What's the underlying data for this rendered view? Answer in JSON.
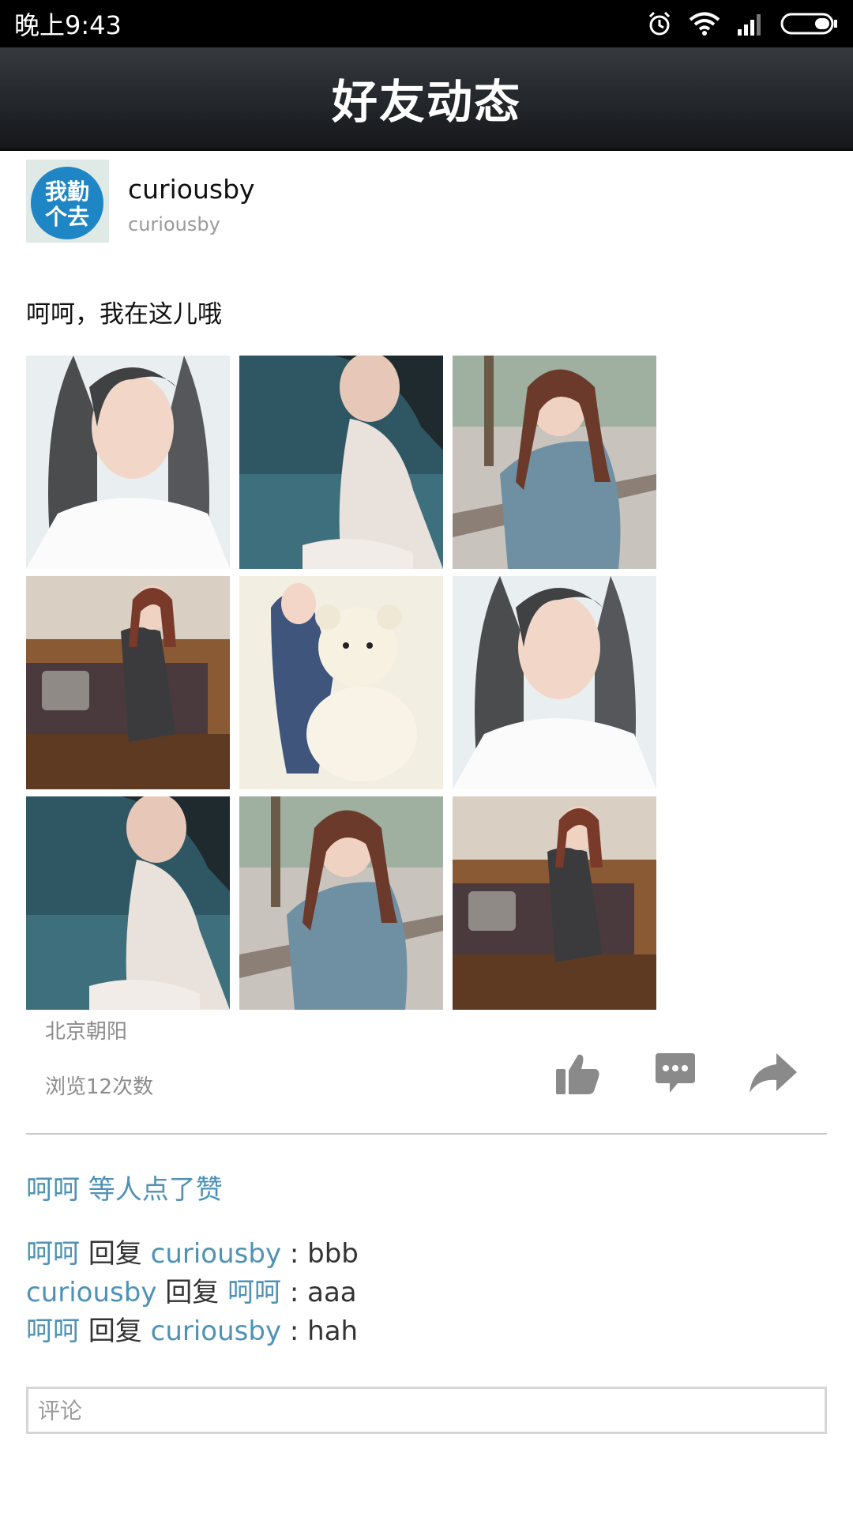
{
  "status_bar": {
    "time": "晚上9:43"
  },
  "header": {
    "title": "好友动态"
  },
  "post": {
    "username": "curiousby",
    "subname": "curiousby",
    "avatar_text": "我勤个去",
    "text": "呵呵，我在这儿哦",
    "location": "北京朝阳",
    "views": "浏览12次数",
    "photo_count": 9
  },
  "likes": {
    "text": "呵呵 等人点了赞"
  },
  "comments": [
    {
      "from": "呵呵",
      "verb": "回复",
      "to": "curiousby",
      "sep": " : ",
      "text": "bbb"
    },
    {
      "from": "curiousby",
      "verb": "回复",
      "to": "呵呵",
      "sep": " : ",
      "text": "aaa"
    },
    {
      "from": "呵呵",
      "verb": "回复",
      "to": "curiousby",
      "sep": " : ",
      "text": "hah"
    }
  ],
  "comment_box": {
    "placeholder": "评论"
  },
  "colors": {
    "link_blue": "#4e92b6",
    "titlebar_top": "#353a3f",
    "titlebar_bottom": "#15171a",
    "icon_gray": "#8a8a8a"
  },
  "icons": {
    "status": [
      "alarm-icon",
      "wifi-icon",
      "signal-icon",
      "battery-icon"
    ],
    "actions": [
      "thumbs-up-icon",
      "comment-icon",
      "share-icon"
    ]
  }
}
